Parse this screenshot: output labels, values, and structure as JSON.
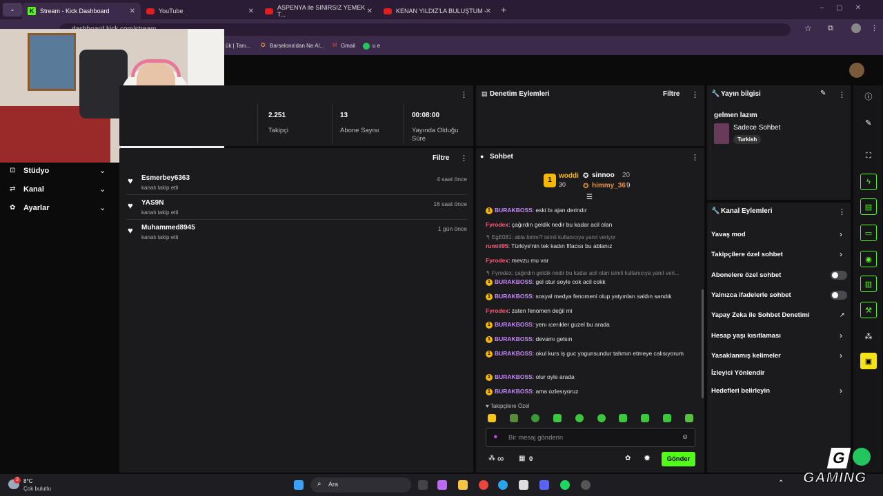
{
  "tabs": [
    {
      "label": "Stream - Kick Dashboard"
    },
    {
      "label": "YouTube"
    },
    {
      "label": "ASPENYA ile SINIRSIZ YEMEK T..."
    },
    {
      "label": "KENAN YILDIZ'LA BULUŞTUM -"
    }
  ],
  "url": "dashboard.kick.com/stream",
  "bookmarks": [
    "ük | Tanı...",
    "Barselona'dan Ne Al...",
    "Gmail",
    "u e"
  ],
  "stats": [
    {
      "value": "2.251",
      "label": "Takipçi"
    },
    {
      "value": "13",
      "label": "Abone Sayısı"
    },
    {
      "value": "00:08:00",
      "label": "Yayında Olduğu Süre"
    }
  ],
  "sidebar": {
    "items": [
      {
        "label": "Stüdyo"
      },
      {
        "label": "Kanal"
      },
      {
        "label": "Ayarlar"
      }
    ]
  },
  "activity": {
    "filter": "Filtre",
    "rows": [
      {
        "name": "Esmerbey6363",
        "desc": "kanalı takip etti",
        "time": "4 saat önce"
      },
      {
        "name": "YAS9N",
        "desc": "kanalı takip etti",
        "time": "16 saat önce"
      },
      {
        "name": "Muhammed8945",
        "desc": "kanalı takip etti",
        "time": "1 gün önce"
      }
    ]
  },
  "moderation": {
    "title": "Denetim Eylemleri",
    "filter": "Filtre"
  },
  "chat": {
    "title": "Sohbet",
    "leader1": {
      "rank": "1",
      "name": "woddi",
      "count": "30"
    },
    "leader2": {
      "name": "sinnoo",
      "count": "20"
    },
    "leader3": {
      "name": "himmy_36",
      "count": "9"
    },
    "messages": [
      {
        "user": "BURAKBOSS",
        "text": ": eski bı ajan derindır"
      },
      {
        "user": "Fyrodex",
        "text": ": çağırdın geldik nedir bu kadar acil olan"
      },
      {
        "reply": "EgE081: abla birimi? isimli kullanıcıya yanıt veriyor"
      },
      {
        "user": "rumiii95",
        "text": ": Türkiye'nin tek kadın fifacısı bu ablanız"
      },
      {
        "user": "Fyrodex",
        "text": ": mevzu mu var"
      },
      {
        "reply": "Fyrodex: çağırdın geldik nedir bu kadar acil olan isimli kullanıcıya yanıt veri..."
      },
      {
        "user": "BURAKBOSS",
        "text": ": gel otur soyle cok acil cokk"
      },
      {
        "user": "BURAKBOSS",
        "text": ": sosyal medya fenomeni olup yatyınları saldın sandık"
      },
      {
        "user": "Fyrodex",
        "text": ": zaten fenomen değil mi"
      },
      {
        "user": "BURAKBOSS",
        "text": ": yenı ıcerıkler guzel bu arada"
      },
      {
        "user": "BURAKBOSS",
        "text": ": devamı gelsın"
      },
      {
        "user": "BURAKBOSS",
        "text": ": okul kurs iş guc yogunsundur tahmın etmeye calısıyorum"
      },
      {
        "user": "BURAKBOSS",
        "text": ": olur oyle arada"
      },
      {
        "user": "BURAKBOSS",
        "text": ": ama ozlesıyoruz"
      }
    ],
    "followers_only": "Takipçilere Özel",
    "placeholder": "Bir mesaj gönderin",
    "infinity": "∞",
    "count": "0",
    "send": "Gönder"
  },
  "info": {
    "title": "Yayın bilgisi",
    "stream_title": "gelmen lazım",
    "category": "Sadece Sohbet",
    "tag": "Turkish"
  },
  "channel": {
    "title": "Kanal Eylemleri",
    "items": [
      "Yavaş mod",
      "Takipçilere özel sohbet",
      "Abonelere özel sohbet",
      "Yalnızca ifadelerle sohbet",
      "Yapay Zeka ile Sohbet Denetimi",
      "Hesap yaşı kısıtlaması",
      "Yasaklanmış kelimeler",
      "İzleyici Yönlendir",
      "Hedefleri belirleyin"
    ]
  },
  "weather": {
    "temp": "8°C",
    "desc": "Çok bulutlu",
    "alert": "3"
  },
  "search": "Ara",
  "watermark": "GAMING"
}
